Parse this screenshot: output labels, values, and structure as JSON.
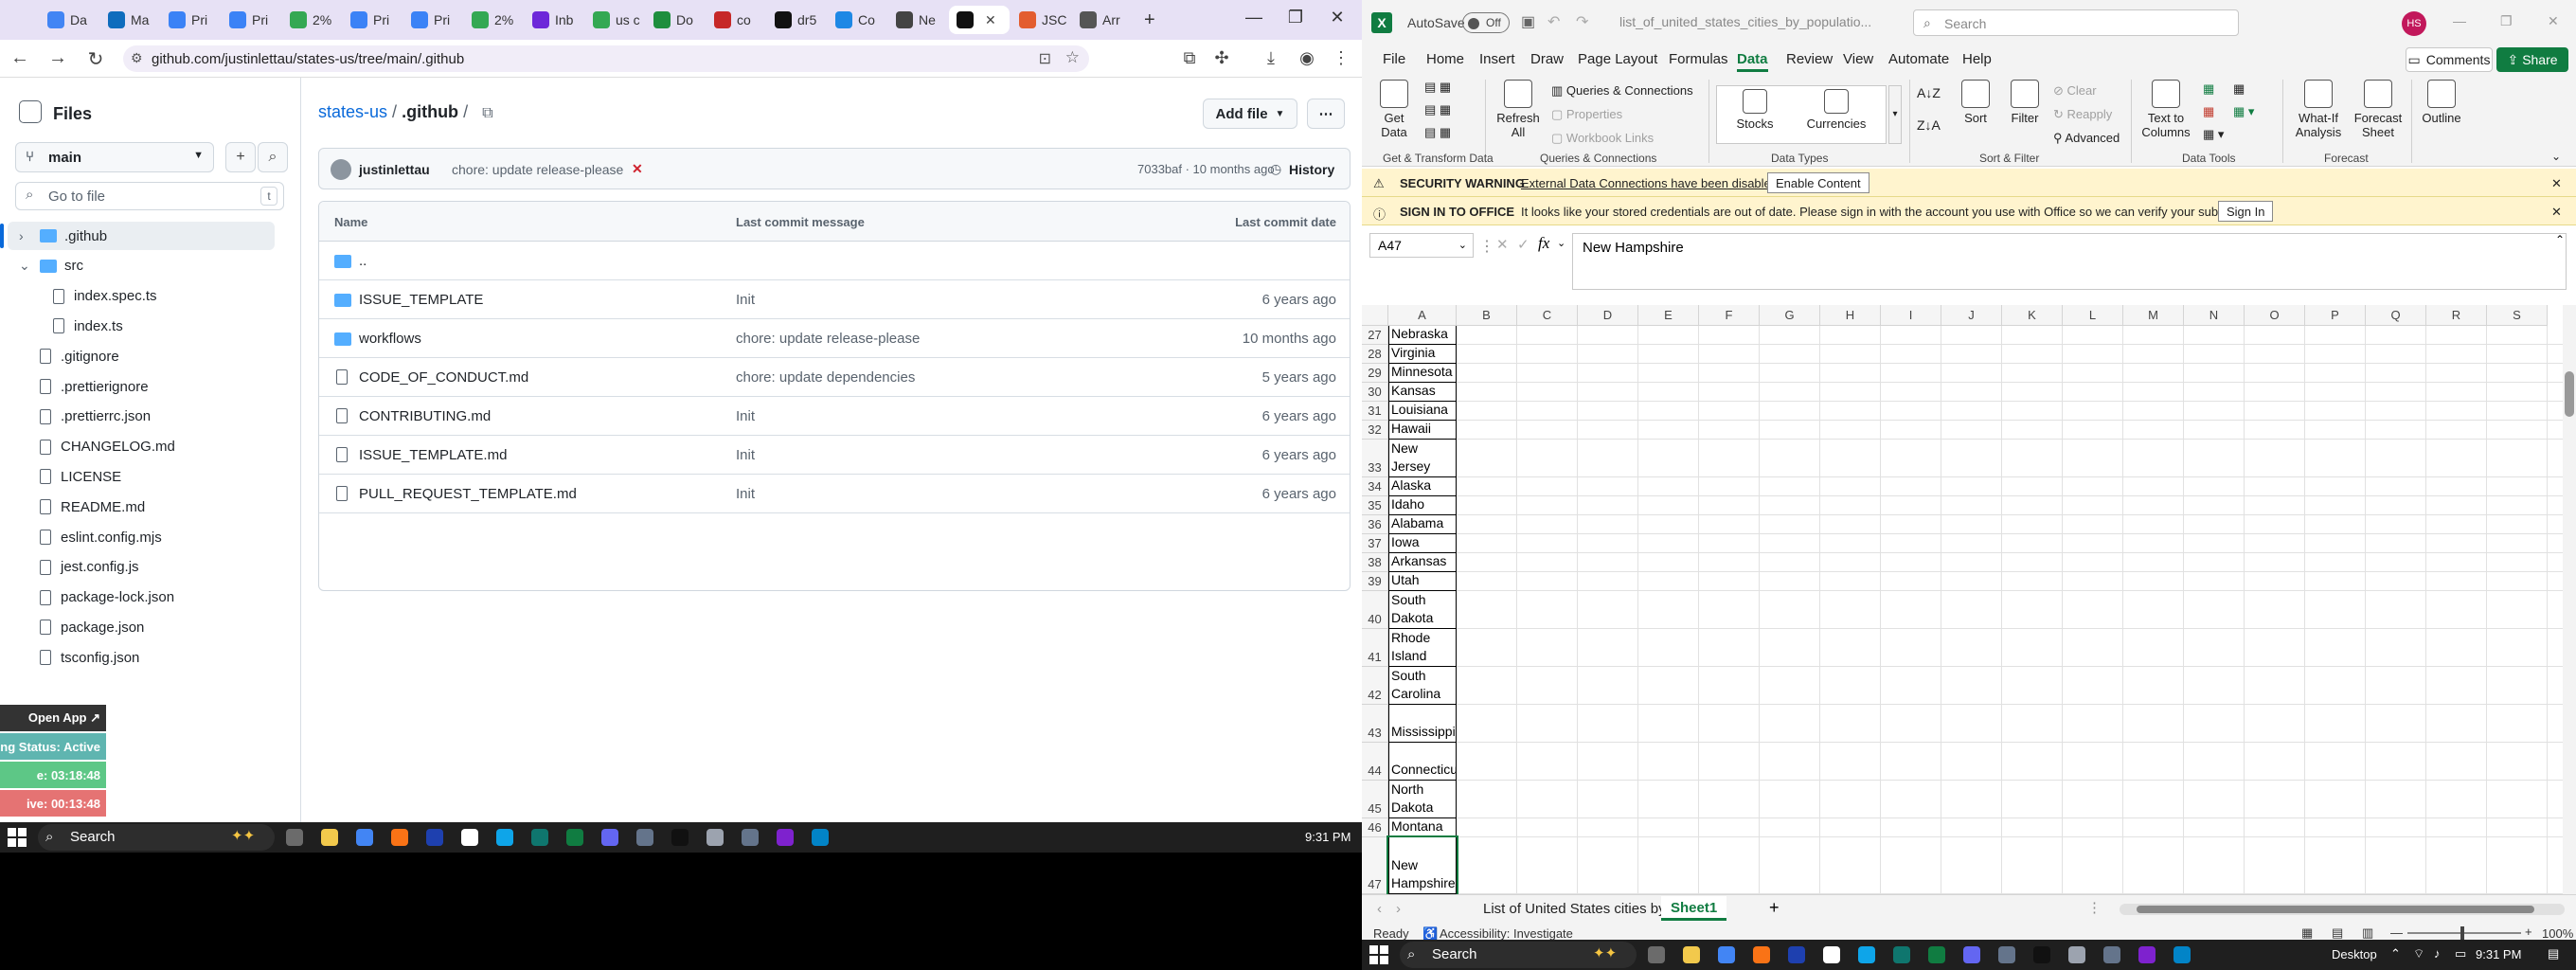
{
  "browser": {
    "tabs": [
      {
        "label": "Da",
        "color": "#4285f4"
      },
      {
        "label": "Ma",
        "color": "#0f6cbd"
      },
      {
        "label": "Pri",
        "color": "#3b82f6"
      },
      {
        "label": "Pri",
        "color": "#3b82f6"
      },
      {
        "label": "2%",
        "color": "#34a853"
      },
      {
        "label": "Pri",
        "color": "#3b82f6"
      },
      {
        "label": "Pri",
        "color": "#3b82f6"
      },
      {
        "label": "2%",
        "color": "#34a853"
      },
      {
        "label": "Inb",
        "color": "#6d28d9"
      },
      {
        "label": "us c",
        "color": "#34a853"
      },
      {
        "label": "Do",
        "color": "#1e8e3e"
      },
      {
        "label": "co",
        "color": "#c62828"
      },
      {
        "label": "dr5",
        "color": "#111111"
      },
      {
        "label": "Co",
        "color": "#1e88e5"
      },
      {
        "label": "Ne",
        "color": "#444444"
      },
      {
        "label": "",
        "color": "#111111"
      },
      {
        "label": "JSC",
        "color": "#e35d2f"
      },
      {
        "label": "Arr",
        "color": "#555555"
      }
    ],
    "url": "github.com/justinlettau/states-us/tree/main/.github"
  },
  "github": {
    "sidebar_title": "Files",
    "branch": "main",
    "goto_placeholder": "Go to file",
    "goto_shortcut": "t",
    "tree": [
      {
        "name": ".github",
        "type": "folder",
        "depth": 0,
        "expand": "›",
        "selected": true
      },
      {
        "name": "src",
        "type": "folder",
        "depth": 0,
        "expand": "⌄",
        "selected": false
      },
      {
        "name": "index.spec.ts",
        "type": "file",
        "depth": 1
      },
      {
        "name": "index.ts",
        "type": "file",
        "depth": 1
      },
      {
        "name": ".gitignore",
        "type": "file",
        "depth": 0
      },
      {
        "name": ".prettierignore",
        "type": "file",
        "depth": 0
      },
      {
        "name": ".prettierrc.json",
        "type": "file",
        "depth": 0
      },
      {
        "name": "CHANGELOG.md",
        "type": "file",
        "depth": 0
      },
      {
        "name": "LICENSE",
        "type": "file",
        "depth": 0
      },
      {
        "name": "README.md",
        "type": "file",
        "depth": 0
      },
      {
        "name": "eslint.config.mjs",
        "type": "file",
        "depth": 0
      },
      {
        "name": "jest.config.js",
        "type": "file",
        "depth": 0
      },
      {
        "name": "package-lock.json",
        "type": "file",
        "depth": 0
      },
      {
        "name": "package.json",
        "type": "file",
        "depth": 0
      },
      {
        "name": "tsconfig.json",
        "type": "file",
        "depth": 0
      }
    ],
    "breadcrumb_repo": "states-us",
    "breadcrumb_sep": "/",
    "breadcrumb_current": ".github",
    "add_file": "Add file",
    "commit": {
      "author": "justinlettau",
      "message": "chore: update release-please",
      "status": "✕",
      "sha_time": "7033baf · 10 months ago",
      "history": "History"
    },
    "table_headers": {
      "name": "Name",
      "message": "Last commit message",
      "date": "Last commit date"
    },
    "rows": [
      {
        "name": "..",
        "type": "folder",
        "message": "",
        "date": ""
      },
      {
        "name": "ISSUE_TEMPLATE",
        "type": "folder",
        "message": "Init",
        "date": "6 years ago"
      },
      {
        "name": "workflows",
        "type": "folder",
        "message": "chore: update release-please",
        "date": "10 months ago"
      },
      {
        "name": "CODE_OF_CONDUCT.md",
        "type": "file",
        "message": "chore: update dependencies",
        "date": "5 years ago"
      },
      {
        "name": "CONTRIBUTING.md",
        "type": "file",
        "message": "Init",
        "date": "6 years ago"
      },
      {
        "name": "ISSUE_TEMPLATE.md",
        "type": "file",
        "message": "Init",
        "date": "6 years ago"
      },
      {
        "name": "PULL_REQUEST_TEMPLATE.md",
        "type": "file",
        "message": "Init",
        "date": "6 years ago"
      }
    ]
  },
  "overlay": {
    "open_app": "Open App ↗",
    "status": "ng Status: Active",
    "timer1": "e: 03:18:48",
    "timer2": "ive: 00:13:48"
  },
  "taskbar_left": {
    "search": "Search",
    "time": "9:31 PM"
  },
  "excel": {
    "autosave_label": "AutoSave",
    "autosave_state": "Off",
    "filename": "list_of_united_states_cities_by_populatio...",
    "search_placeholder": "Search",
    "avatar": "HS",
    "menus": [
      "File",
      "Home",
      "Insert",
      "Draw",
      "Page Layout",
      "Formulas",
      "Data",
      "Review",
      "View",
      "Automate",
      "Help"
    ],
    "active_menu": "Data",
    "comments": "Comments",
    "share": "Share",
    "ribbon": {
      "get_data": "Get\nData",
      "refresh_all": "Refresh\nAll",
      "queries_connections": "Queries & Connections",
      "properties": "Properties",
      "workbook_links": "Workbook Links",
      "stocks": "Stocks",
      "currencies": "Currencies",
      "sort": "Sort",
      "filter": "Filter",
      "clear": "Clear",
      "reapply": "Reapply",
      "advanced": "Advanced",
      "text_to_columns": "Text to\nColumns",
      "what_if": "What-If\nAnalysis",
      "forecast_sheet": "Forecast\nSheet",
      "outline": "Outline",
      "groups": [
        "Get & Transform Data",
        "Queries & Connections",
        "Data Types",
        "Sort & Filter",
        "Data Tools",
        "Forecast"
      ]
    },
    "security": {
      "label": "SECURITY WARNING",
      "text": "External Data Connections have been disabled",
      "button": "Enable Content"
    },
    "signin": {
      "label": "SIGN IN TO OFFICE",
      "text": "It looks like your stored credentials are out of date. Please sign in with the account you use with Office so we can verify your subscription.",
      "button": "Sign In"
    },
    "namebox": "A47",
    "formula": "New Hampshire",
    "columns": [
      "A",
      "B",
      "C",
      "D",
      "E",
      "F",
      "G",
      "H",
      "I",
      "J",
      "K",
      "L",
      "M",
      "N",
      "O",
      "P",
      "Q",
      "R",
      "S"
    ],
    "rows": [
      {
        "n": "27",
        "v": "Nebraska",
        "lines": 1
      },
      {
        "n": "28",
        "v": "Virginia",
        "lines": 1
      },
      {
        "n": "29",
        "v": "Minnesota",
        "lines": 1
      },
      {
        "n": "30",
        "v": "Kansas",
        "lines": 1
      },
      {
        "n": "31",
        "v": "Louisiana",
        "lines": 1
      },
      {
        "n": "32",
        "v": "Hawaii",
        "lines": 1
      },
      {
        "n": "33",
        "v": "New Jersey",
        "lines": 2
      },
      {
        "n": "34",
        "v": "Alaska",
        "lines": 1
      },
      {
        "n": "35",
        "v": "Idaho",
        "lines": 1
      },
      {
        "n": "36",
        "v": "Alabama",
        "lines": 1
      },
      {
        "n": "37",
        "v": "Iowa",
        "lines": 1
      },
      {
        "n": "38",
        "v": "Arkansas",
        "lines": 1
      },
      {
        "n": "39",
        "v": "Utah",
        "lines": 1
      },
      {
        "n": "40",
        "v": "South Dakota",
        "lines": 2
      },
      {
        "n": "41",
        "v": "Rhode Island",
        "lines": 2
      },
      {
        "n": "42",
        "v": "South Carolina",
        "lines": 2
      },
      {
        "n": "43",
        "v": "Mississippi",
        "lines": 2
      },
      {
        "n": "44",
        "v": "Connecticut",
        "lines": 2
      },
      {
        "n": "45",
        "v": "North Dakota",
        "lines": 2
      },
      {
        "n": "46",
        "v": "Montana",
        "lines": 1
      },
      {
        "n": "47",
        "v": "New Hampshire",
        "lines": 3
      }
    ],
    "sheet_tabs": [
      "List of United States cities by",
      "Sheet1"
    ],
    "active_sheet": "Sheet1",
    "status_ready": "Ready",
    "status_access": "Accessibility: Investigate",
    "zoom": "100%"
  },
  "taskbar_right": {
    "search": "Search",
    "desktop": "Desktop",
    "time": "9:31 PM"
  }
}
